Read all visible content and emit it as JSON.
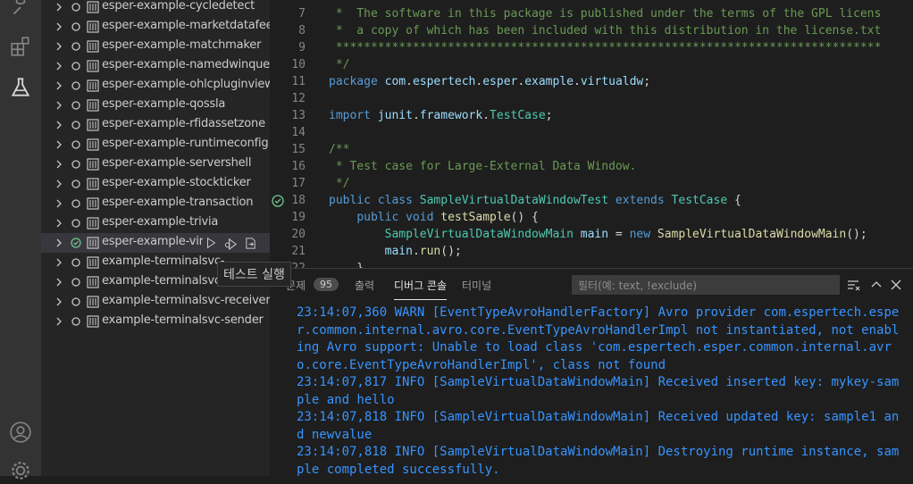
{
  "activity_bar": {
    "icons": [
      "debug-icon",
      "extensions-icon",
      "testing-icon",
      "account-icon",
      "settings-gear-icon"
    ]
  },
  "test_tree": {
    "items": [
      {
        "label": "esper-example-cycledetect",
        "status": "idle"
      },
      {
        "label": "esper-example-marketdatafeed",
        "status": "idle"
      },
      {
        "label": "esper-example-matchmaker",
        "status": "idle"
      },
      {
        "label": "esper-example-namedwinquery",
        "status": "idle"
      },
      {
        "label": "esper-example-ohlcpluginview",
        "status": "idle"
      },
      {
        "label": "esper-example-qossla",
        "status": "idle"
      },
      {
        "label": "esper-example-rfidassetzone",
        "status": "idle"
      },
      {
        "label": "esper-example-runtimeconfig",
        "status": "idle"
      },
      {
        "label": "esper-example-servershell",
        "status": "idle"
      },
      {
        "label": "esper-example-stockticker",
        "status": "idle"
      },
      {
        "label": "esper-example-transaction",
        "status": "idle"
      },
      {
        "label": "esper-example-trivia",
        "status": "idle"
      },
      {
        "label": "esper-example-virt",
        "status": "passed",
        "selected": true
      },
      {
        "label": "example-terminalsvc-",
        "status": "idle"
      },
      {
        "label": "example-terminalsvc-",
        "status": "idle"
      },
      {
        "label": "example-terminalsvc-receiver",
        "status": "idle"
      },
      {
        "label": "example-terminalsvc-sender",
        "status": "idle"
      }
    ],
    "tooltip": "테스트 실행"
  },
  "editor": {
    "lines": [
      {
        "num": "7",
        "text": " *  The software in this package is published under the terms of the GPL licens"
      },
      {
        "num": "8",
        "text": " *  a copy of which has been included with this distribution in the license.txt"
      },
      {
        "num": "9",
        "text": " ******************************************************************************"
      },
      {
        "num": "10",
        "text": " */"
      },
      {
        "num": "11",
        "text": "package com.espertech.esper.example.virtualdw;"
      },
      {
        "num": "12",
        "text": ""
      },
      {
        "num": "13",
        "text": "import junit.framework.TestCase;"
      },
      {
        "num": "14",
        "text": ""
      },
      {
        "num": "15",
        "text": "/**"
      },
      {
        "num": "16",
        "text": " * Test case for Large-External Data Window."
      },
      {
        "num": "17",
        "text": " */"
      },
      {
        "num": "18",
        "text": "public class SampleVirtualDataWindowTest extends TestCase {"
      },
      {
        "num": "19",
        "text": "    public void testSample() {"
      },
      {
        "num": "20",
        "text": "        SampleVirtualDataWindowMain main = new SampleVirtualDataWindowMain();"
      },
      {
        "num": "21",
        "text": "        main.run();"
      },
      {
        "num": "22",
        "text": "    }"
      }
    ]
  },
  "panel": {
    "tabs": [
      {
        "label": "문제",
        "active": false
      },
      {
        "label": "출력",
        "active": false
      },
      {
        "label": "디버그 콘솔",
        "active": true
      },
      {
        "label": "터미널",
        "active": false
      }
    ],
    "problems_count": "95",
    "filter_placeholder": "필터(예: text, !exclude)",
    "console_lines": [
      "23:14:07,360 WARN  [EventTypeAvroHandlerFactory] Avro provider com.espertech.esper.common.internal.avro.core.EventTypeAvroHandlerImpl not instantiated, not enabling Avro support: Unable to load class 'com.espertech.esper.common.internal.avro.core.EventTypeAvroHandlerImpl', class not found",
      "23:14:07,817 INFO  [SampleVirtualDataWindowMain] Received inserted key: mykey-sample and hello",
      "23:14:07,818 INFO  [SampleVirtualDataWindowMain] Received updated key: sample1 and newvalue",
      "23:14:07,818 INFO  [SampleVirtualDataWindowMain] Destroying runtime instance, sample completed successfully."
    ]
  },
  "colors": {
    "accent": "#3794ff",
    "passed": "#73c991",
    "comment": "#6a9955",
    "keyword": "#569cd6",
    "type": "#4ec9b0"
  }
}
